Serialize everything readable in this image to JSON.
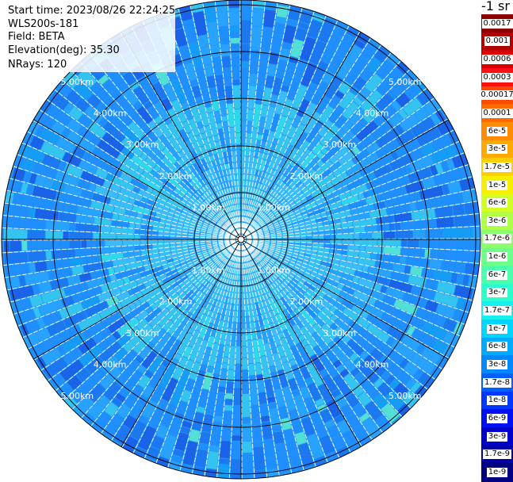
{
  "info": {
    "start_time": "Start time: 2023/08/26 22:24:25",
    "instrument": "WLS200s-181",
    "field": "Field: BETA",
    "elevation": "Elevation(deg): 35.30",
    "nrays": "NRays: 120"
  },
  "colorbar": {
    "title": "-1 sr",
    "segments": [
      {
        "label": "0.0017",
        "color": "#8b0000"
      },
      {
        "label": "0.001",
        "color": "#b50000"
      },
      {
        "label": "0.0006",
        "color": "#d80000"
      },
      {
        "label": "0.0003",
        "color": "#ff1010"
      },
      {
        "label": "0.00017",
        "color": "#ff4a00"
      },
      {
        "label": "0.0001",
        "color": "#ff6a00"
      },
      {
        "label": "6e-5",
        "color": "#ff8c00"
      },
      {
        "label": "3e-5",
        "color": "#ffaa00"
      },
      {
        "label": "1.7e-5",
        "color": "#ffd000"
      },
      {
        "label": "1e-5",
        "color": "#f4f000"
      },
      {
        "label": "6e-6",
        "color": "#d2ff25"
      },
      {
        "label": "3e-6",
        "color": "#b0ff47"
      },
      {
        "label": "1.7e-6",
        "color": "#8cff6c"
      },
      {
        "label": "1e-6",
        "color": "#6cff8c"
      },
      {
        "label": "6e-7",
        "color": "#4cffac"
      },
      {
        "label": "3e-7",
        "color": "#2cffcc"
      },
      {
        "label": "1.7e-7",
        "color": "#16f0ee"
      },
      {
        "label": "1e-7",
        "color": "#00d4ff"
      },
      {
        "label": "6e-8",
        "color": "#00aaff"
      },
      {
        "label": "3e-8",
        "color": "#0088ff"
      },
      {
        "label": "1.7e-8",
        "color": "#0060ff"
      },
      {
        "label": "1e-8",
        "color": "#0038ff"
      },
      {
        "label": "6e-9",
        "color": "#0010ee"
      },
      {
        "label": "3e-9",
        "color": "#0000cc"
      },
      {
        "label": "1.7e-9",
        "color": "#0000a4"
      },
      {
        "label": "1e-9",
        "color": "#000080"
      }
    ]
  },
  "range_labels": [
    "1.00km",
    "2.00km",
    "3.00km",
    "4.00km",
    "5.00km"
  ],
  "palette": {
    "field_colors": [
      "#1f8fff",
      "#27a3ff",
      "#1c78f0",
      "#3bbcfa",
      "#159cf5",
      "#33c4f0",
      "#1a62e8",
      "#2fd6ec",
      "#52e0d6"
    ],
    "grid_color": "#000000",
    "gap_color": "#ffffff"
  }
}
